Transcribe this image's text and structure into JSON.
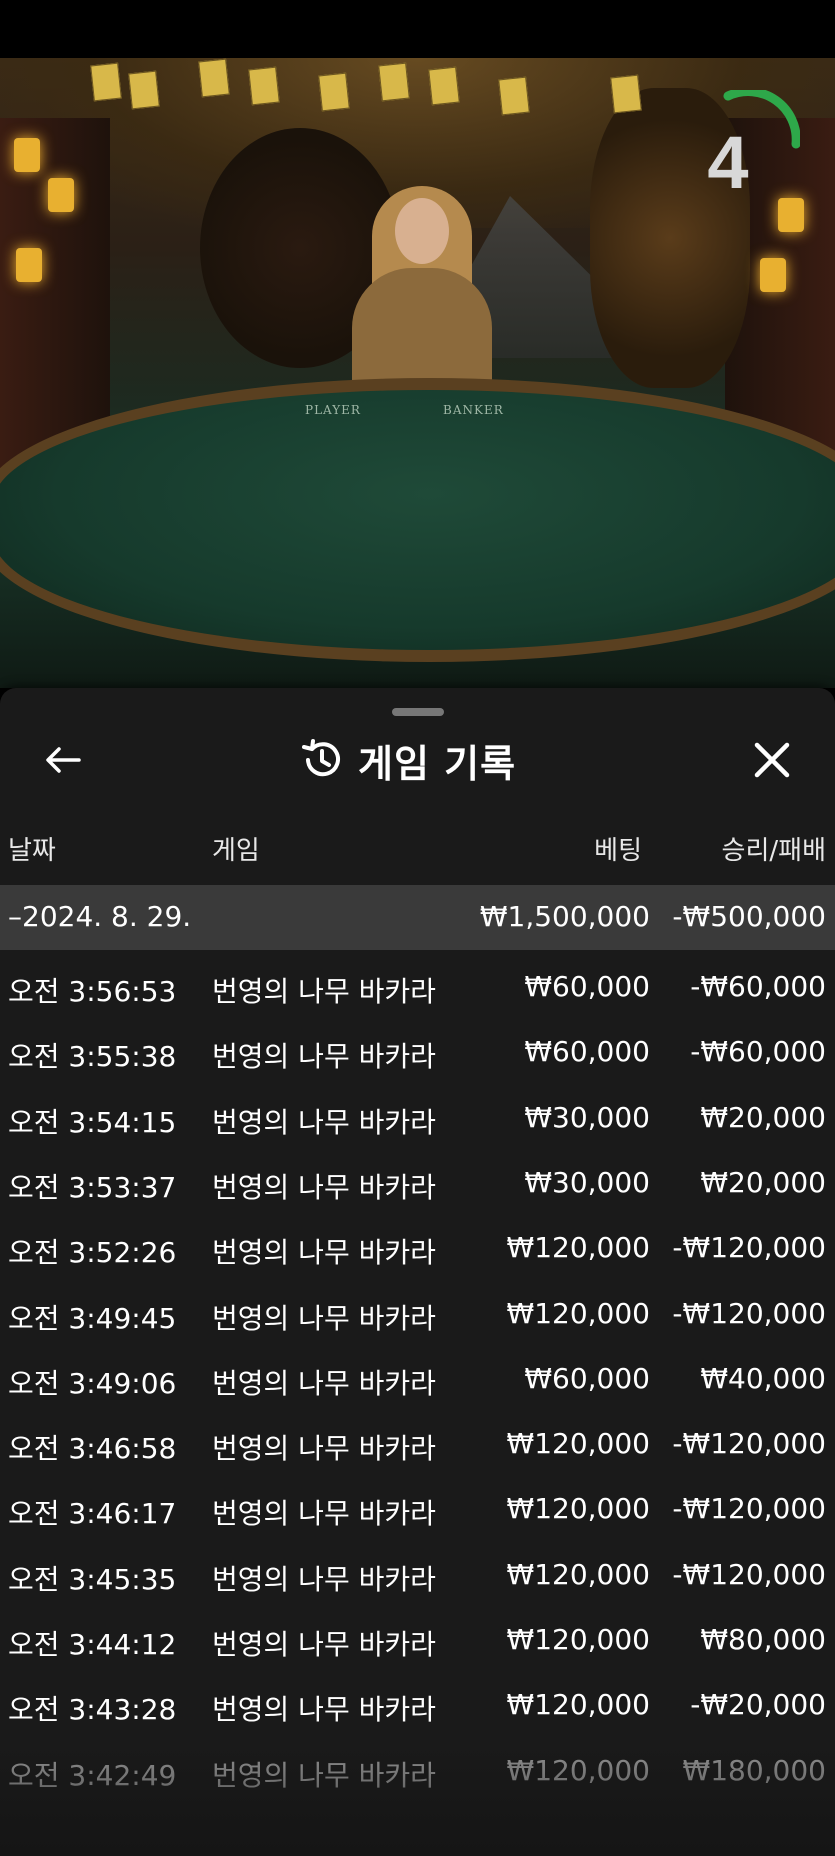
{
  "video": {
    "countdown": "4",
    "table_labels": {
      "player": "PLAYER",
      "banker": "BANKER"
    }
  },
  "panel": {
    "title": "게임 기록",
    "columns": {
      "date": "날짜",
      "game": "게임",
      "bet": "베팅",
      "result": "승리/패배"
    },
    "summary": {
      "date": "–2024. 8. 29.",
      "bet": "₩1,500,000",
      "result": "-₩500,000"
    },
    "rows": [
      {
        "time": "오전 3:56:53",
        "game": "번영의 나무 바카라",
        "bet": "₩60,000",
        "result": "-₩60,000"
      },
      {
        "time": "오전 3:55:38",
        "game": "번영의 나무 바카라",
        "bet": "₩60,000",
        "result": "-₩60,000"
      },
      {
        "time": "오전 3:54:15",
        "game": "번영의 나무 바카라",
        "bet": "₩30,000",
        "result": "₩20,000"
      },
      {
        "time": "오전 3:53:37",
        "game": "번영의 나무 바카라",
        "bet": "₩30,000",
        "result": "₩20,000"
      },
      {
        "time": "오전 3:52:26",
        "game": "번영의 나무 바카라",
        "bet": "₩120,000",
        "result": "-₩120,000"
      },
      {
        "time": "오전 3:49:45",
        "game": "번영의 나무 바카라",
        "bet": "₩120,000",
        "result": "-₩120,000"
      },
      {
        "time": "오전 3:49:06",
        "game": "번영의 나무 바카라",
        "bet": "₩60,000",
        "result": "₩40,000"
      },
      {
        "time": "오전 3:46:58",
        "game": "번영의 나무 바카라",
        "bet": "₩120,000",
        "result": "-₩120,000"
      },
      {
        "time": "오전 3:46:17",
        "game": "번영의 나무 바카라",
        "bet": "₩120,000",
        "result": "-₩120,000"
      },
      {
        "time": "오전 3:45:35",
        "game": "번영의 나무 바카라",
        "bet": "₩120,000",
        "result": "-₩120,000"
      },
      {
        "time": "오전 3:44:12",
        "game": "번영의 나무 바카라",
        "bet": "₩120,000",
        "result": "₩80,000"
      },
      {
        "time": "오전 3:43:28",
        "game": "번영의 나무 바카라",
        "bet": "₩120,000",
        "result": "-₩20,000"
      },
      {
        "time": "오전 3:42:49",
        "game": "번영의 나무 바카라",
        "bet": "₩120,000",
        "result": "₩180,000"
      }
    ]
  },
  "icons": {
    "back": "arrow-left-icon",
    "history": "history-clock-icon",
    "close": "close-icon"
  },
  "colors": {
    "panel_bg": "#1a1a1a",
    "summary_bg": "#3a3a3a",
    "timer_green": "#2ea84a",
    "text": "#ffffff"
  }
}
